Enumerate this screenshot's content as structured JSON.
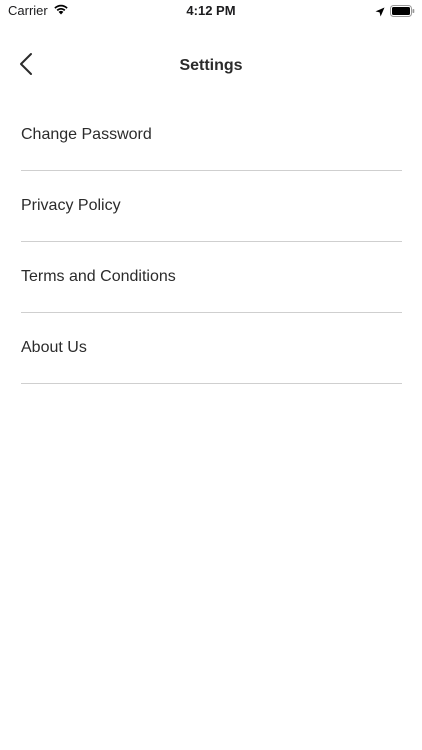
{
  "status_bar": {
    "carrier": "Carrier",
    "time": "4:12 PM",
    "icons": [
      "wifi-icon",
      "location-arrow-icon",
      "battery-icon"
    ]
  },
  "nav": {
    "title": "Settings",
    "back_icon": "chevron-left-icon"
  },
  "menu": {
    "items": [
      {
        "label": "Change Password"
      },
      {
        "label": "Privacy Policy"
      },
      {
        "label": "Terms and Conditions"
      },
      {
        "label": "About Us"
      }
    ]
  },
  "colors": {
    "background": "#ffffff",
    "text": "#2b2b2b",
    "divider": "#cfcfcf"
  }
}
